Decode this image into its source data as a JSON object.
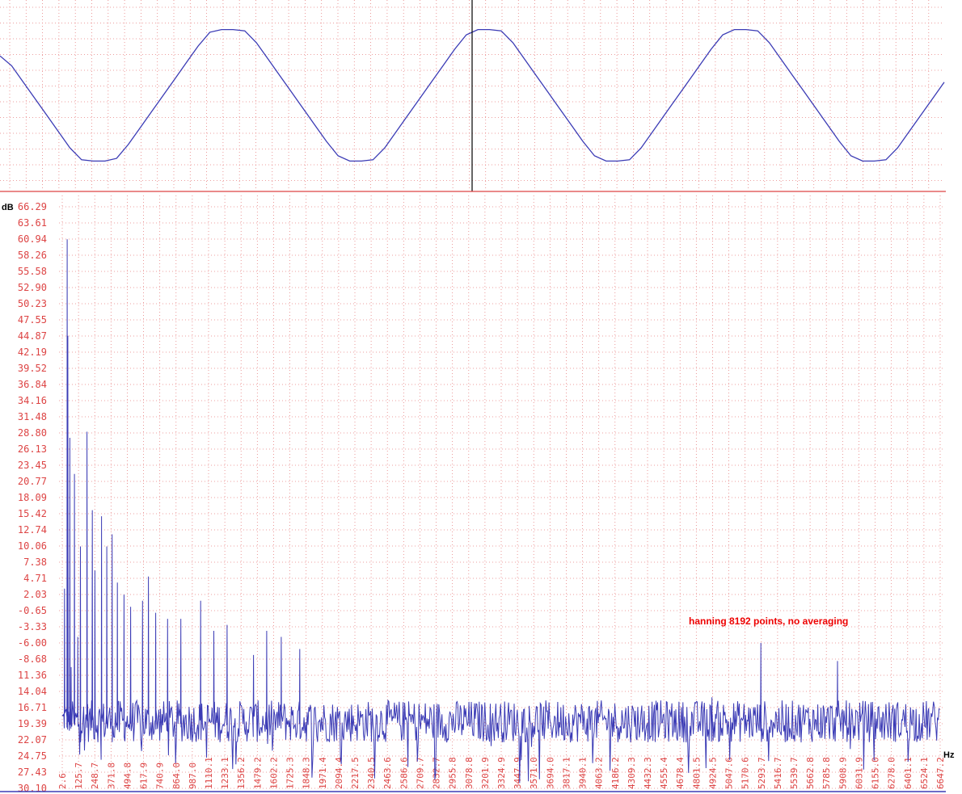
{
  "chart_data": [
    {
      "type": "line",
      "panel": "waveform",
      "series": [
        {
          "color": "#3b3bb5",
          "x": [
            0,
            0.05,
            0.1,
            0.15,
            0.2,
            0.25,
            0.3,
            0.35,
            0.4,
            0.45,
            0.5,
            0.55,
            0.6,
            0.65,
            0.7,
            0.75,
            0.8,
            0.85,
            0.9,
            0.95,
            1.0,
            1.05,
            1.1,
            1.15,
            1.2,
            1.25,
            1.3,
            1.35,
            1.4,
            1.45,
            1.5,
            1.55,
            1.6,
            1.65,
            1.7,
            1.75,
            1.8,
            1.85,
            1.9,
            1.95,
            2.0,
            2.05,
            2.1,
            2.15,
            2.2,
            2.25,
            2.3,
            2.35,
            2.4,
            2.45,
            2.5,
            2.55,
            2.6,
            2.65,
            2.7,
            2.75,
            2.8,
            2.85,
            2.9,
            2.95,
            3.0,
            3.05,
            3.1,
            3.15,
            3.2,
            3.25,
            3.3,
            3.35,
            3.4,
            3.45,
            3.5,
            3.55,
            3.6,
            3.65,
            3.7,
            3.75,
            3.8,
            3.85,
            3.9,
            3.95,
            4.0,
            4.05
          ],
          "y": [
            0.6,
            0.45,
            0.2,
            -0.05,
            -0.3,
            -0.55,
            -0.8,
            -0.98,
            -1.0,
            -1.0,
            -0.96,
            -0.75,
            -0.5,
            -0.25,
            0.0,
            0.25,
            0.5,
            0.75,
            0.96,
            1.0,
            1.0,
            0.98,
            0.8,
            0.55,
            0.3,
            0.05,
            -0.2,
            -0.45,
            -0.7,
            -0.92,
            -1.0,
            -1.0,
            -0.98,
            -0.8,
            -0.55,
            -0.3,
            -0.05,
            0.2,
            0.45,
            0.7,
            0.92,
            1.0,
            1.0,
            0.98,
            0.8,
            0.55,
            0.3,
            0.05,
            -0.2,
            -0.45,
            -0.7,
            -0.92,
            -1.0,
            -1.0,
            -0.98,
            -0.8,
            -0.55,
            -0.3,
            -0.05,
            0.2,
            0.45,
            0.7,
            0.92,
            1.0,
            1.0,
            0.98,
            0.8,
            0.55,
            0.3,
            0.05,
            -0.2,
            -0.45,
            -0.7,
            -0.92,
            -1.0,
            -1.0,
            -0.98,
            -0.8,
            -0.55,
            -0.3,
            -0.05,
            0.2
          ]
        }
      ],
      "cursor_x": 2.0,
      "ylim": [
        -1.45,
        1.45
      ]
    },
    {
      "type": "line",
      "panel": "spectrum",
      "ylabel": "dB",
      "xlabel": "Hz",
      "y_ticks": [
        "66.29",
        "63.61",
        "60.94",
        "58.26",
        "55.58",
        "52.90",
        "50.23",
        "47.55",
        "44.87",
        "42.19",
        "39.52",
        "36.84",
        "34.16",
        "31.48",
        "28.80",
        "26.13",
        "23.45",
        "20.77",
        "18.09",
        "15.42",
        "12.74",
        "10.06",
        "7.38",
        "4.71",
        "2.03",
        "-0.65",
        "-3.33",
        "-6.00",
        "-8.68",
        "11.36",
        "14.04",
        "16.71",
        "19.39",
        "22.07",
        "24.75",
        "27.43",
        "30.10"
      ],
      "x_ticks": [
        "2.6",
        "125.7",
        "248.7",
        "371.8",
        "494.8",
        "617.9",
        "740.9",
        "864.0",
        "987.0",
        "1110.1",
        "1233.1",
        "1356.2",
        "1479.2",
        "1602.2",
        "1725.3",
        "1848.3",
        "1971.4",
        "2094.4",
        "2217.5",
        "2340.5",
        "2463.6",
        "2586.6",
        "2709.7",
        "2832.7",
        "2955.8",
        "3078.8",
        "3201.9",
        "3324.9",
        "3447.9",
        "3571.0",
        "3694.0",
        "3817.1",
        "3940.1",
        "4063.2",
        "4186.2",
        "4309.3",
        "4432.3",
        "4555.4",
        "4678.4",
        "4801.5",
        "4924.5",
        "5047.6",
        "5170.6",
        "5293.7",
        "5416.7",
        "5539.7",
        "5662.8",
        "5785.8",
        "5908.9",
        "6031.9",
        "6155.0",
        "6278.0",
        "6401.1",
        "6524.1",
        "6647.2"
      ],
      "xlim": [
        2.6,
        6647.2
      ],
      "ylim": [
        -30.1,
        66.29
      ],
      "series": [
        {
          "color": "#3b3bb5",
          "noise_floor_db": -19,
          "noise_amplitude_db": 3.5,
          "peaks": [
            {
              "x": 20,
              "y": 3
            },
            {
              "x": 40,
              "y": 60.9
            },
            {
              "x": 45,
              "y": 44.9
            },
            {
              "x": 60,
              "y": 28
            },
            {
              "x": 70,
              "y": -10
            },
            {
              "x": 95,
              "y": 22
            },
            {
              "x": 120,
              "y": -5
            },
            {
              "x": 140,
              "y": 10
            },
            {
              "x": 190,
              "y": 29
            },
            {
              "x": 230,
              "y": 16
            },
            {
              "x": 250,
              "y": 6
            },
            {
              "x": 300,
              "y": 15
            },
            {
              "x": 340,
              "y": 10
            },
            {
              "x": 380,
              "y": 12
            },
            {
              "x": 420,
              "y": 4
            },
            {
              "x": 470,
              "y": 2
            },
            {
              "x": 520,
              "y": 0
            },
            {
              "x": 610,
              "y": 1
            },
            {
              "x": 655,
              "y": 5
            },
            {
              "x": 710,
              "y": -1
            },
            {
              "x": 800,
              "y": -2
            },
            {
              "x": 900,
              "y": -2
            },
            {
              "x": 1050,
              "y": 1
            },
            {
              "x": 1150,
              "y": -4
            },
            {
              "x": 1250,
              "y": -3
            },
            {
              "x": 1450,
              "y": -8
            },
            {
              "x": 1550,
              "y": -4
            },
            {
              "x": 1660,
              "y": -5
            },
            {
              "x": 1800,
              "y": -7
            },
            {
              "x": 4920,
              "y": -15
            },
            {
              "x": 5290,
              "y": -6
            },
            {
              "x": 5870,
              "y": -9
            }
          ]
        }
      ]
    }
  ],
  "annotation": "hanning 8192 points, no averaging"
}
